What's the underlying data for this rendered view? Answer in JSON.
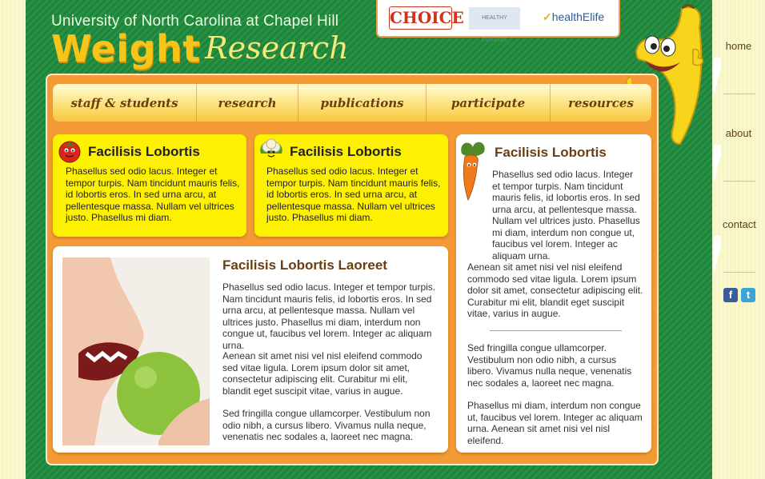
{
  "header": {
    "university": "University of North Carolina at Chapel Hill",
    "title_main": "Weight",
    "title_script": "Research"
  },
  "partners": {
    "choice": "CHOICE",
    "healthy_families": "HEALTHY FAMILIES",
    "healthelife_check": "✓",
    "healthelife": "healthElife"
  },
  "nav": {
    "items": [
      {
        "label": "staff & students"
      },
      {
        "label": "research"
      },
      {
        "label": "publications"
      },
      {
        "label": "participate"
      },
      {
        "label": "resources"
      }
    ]
  },
  "cards": {
    "card1": {
      "title": "Facilisis Lobortis",
      "body": "Phasellus sed odio lacus. Integer et tempor turpis. Nam tincidunt mauris felis, id lobortis eros. In sed urna arcu, at pellentesque massa. Nullam vel ultrices justo. Phasellus mi diam."
    },
    "card2": {
      "title": "Facilisis Lobortis",
      "body": "Phasellus sed odio lacus. Integer et tempor turpis. Nam tincidunt mauris felis, id lobortis eros. In sed urna arcu, at pellentesque massa. Nullam vel ultrices justo. Phasellus mi diam."
    },
    "side": {
      "title": "Facilisis Lobortis",
      "p1": "Phasellus sed odio lacus. Integer et tempor turpis. Nam tincidunt mauris felis, id lobortis eros. In sed urna arcu, at pellentesque massa. Nullam vel ultrices justo. Phasellus mi diam, interdum non congue ut, faucibus vel lorem. Integer ac aliquam urna.",
      "p2": "Aenean sit amet nisi vel nisl eleifend commodo sed vitae ligula. Lorem ipsum dolor sit amet, consectetur adipiscing elit. Curabitur mi elit, blandit eget suscipit vitae, varius in augue.",
      "p3": "Sed fringilla congue ullamcorper. Vestibulum non odio nibh, a cursus libero. Vivamus nulla neque, venenatis nec sodales a, laoreet nec magna.",
      "p4": "Phasellus mi diam, interdum non congue ut, faucibus vel lorem. Integer ac aliquam urna. Aenean sit amet nisi vel nisl eleifend."
    },
    "main": {
      "title": "Facilisis Lobortis Laoreet",
      "p1": "Phasellus sed odio lacus. Integer et tempor turpis. Nam tincidunt mauris felis, id lobortis eros. In sed urna arcu, at pellentesque massa. Nullam vel ultrices justo. Phasellus mi diam, interdum non congue ut, faucibus vel lorem. Integer ac aliquam urna.",
      "p2": "Aenean sit amet nisi vel nisl eleifend commodo sed vitae ligula. Lorem ipsum dolor sit amet, consectetur adipiscing elit. Curabitur mi elit, blandit eget suscipit vitae, varius in augue.",
      "p3": "Sed fringilla congue ullamcorper. Vestibulum non odio nibh, a cursus libero. Vivamus nulla neque, venenatis nec sodales a, laoreet nec magna."
    }
  },
  "sidenav": {
    "home": "home",
    "about": "about",
    "contact": "contact",
    "facebook": "f",
    "twitter": "t"
  },
  "colors": {
    "green": "#1e8a3c",
    "orange": "#f39a37",
    "yellow": "#fef001",
    "brand_gold": "#f7c51a"
  },
  "icons": [
    "tomato-icon",
    "cauliflower-icon",
    "carrot-icon",
    "banana-mascot",
    "facebook-icon",
    "twitter-icon"
  ]
}
